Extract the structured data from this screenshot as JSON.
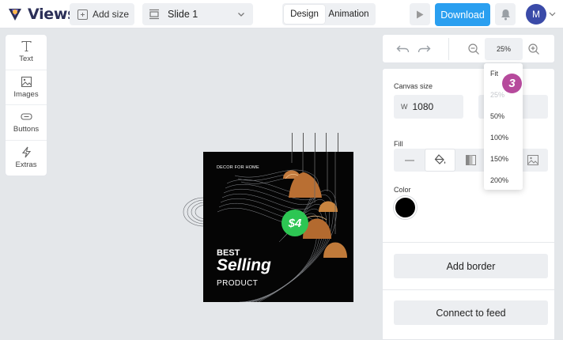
{
  "app": {
    "logo_text": "Viewst"
  },
  "topbar": {
    "add_size_label": "Add size",
    "slide_select_value": "Slide 1",
    "mode_tabs": [
      "Design",
      "Animation"
    ],
    "active_mode": "Design",
    "download_label": "Download",
    "avatar_initial": "M"
  },
  "left_tools": [
    {
      "label": "Text",
      "icon": "text-icon"
    },
    {
      "label": "Images",
      "icon": "image-icon"
    },
    {
      "label": "Buttons",
      "icon": "button-icon"
    },
    {
      "label": "Extras",
      "icon": "lightning-icon"
    }
  ],
  "canvas": {
    "decor_text": "DECOR FOR HOME",
    "price": "$4",
    "headline_best": "BEST",
    "headline_selling": "Selling",
    "headline_product": "PRODUCT",
    "background_color": "#050505",
    "badge_color": "#2dc653"
  },
  "zoom": {
    "current": "25%",
    "options": [
      "Fit",
      "25%",
      "50%",
      "100%",
      "150%",
      "200%"
    ],
    "disabled_option": "25%"
  },
  "props": {
    "canvas_size_label": "Canvas size",
    "width_prefix": "W",
    "width_value": "1080",
    "fill_label": "Fill",
    "color_label": "Color",
    "color_value": "#000000",
    "add_border_label": "Add border",
    "connect_feed_label": "Connect to feed"
  },
  "step_badge": "3",
  "colors": {
    "accent": "#2a9ff0",
    "step_badge": "#b64a9c",
    "avatar": "#3a4aa8"
  }
}
